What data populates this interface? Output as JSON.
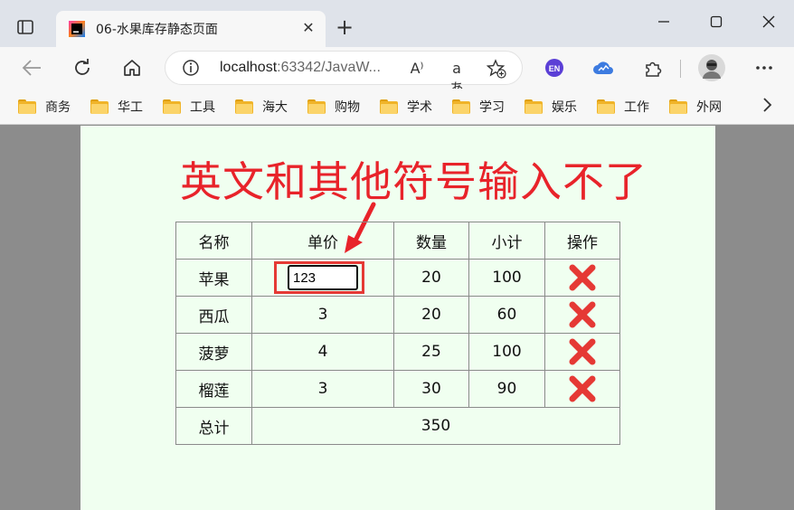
{
  "browser": {
    "tab_title": "06-水果库存静态页面",
    "tab_close": "✕",
    "new_tab": "+",
    "address_host": "localhost",
    "address_rest": ":63342/JavaW...",
    "read_aloud_icon": "A⁾",
    "translate_icon": "aあ",
    "extension_en": "EN",
    "bookmarks": [
      "商务",
      "华工",
      "工具",
      "海大",
      "购物",
      "学术",
      "学习",
      "娱乐",
      "工作",
      "外网"
    ]
  },
  "page": {
    "headline": "英文和其他符号输入不了",
    "table": {
      "headers": [
        "名称",
        "单价",
        "数量",
        "小计",
        "操作"
      ],
      "rows": [
        {
          "name": "苹果",
          "price": "123",
          "qty": "20",
          "subtotal": "100"
        },
        {
          "name": "西瓜",
          "price": "3",
          "qty": "20",
          "subtotal": "60"
        },
        {
          "name": "菠萝",
          "price": "4",
          "qty": "25",
          "subtotal": "100"
        },
        {
          "name": "榴莲",
          "price": "3",
          "qty": "30",
          "subtotal": "90"
        }
      ],
      "total_label": "总计",
      "total_value": "350"
    },
    "colors": {
      "annotation_red": "#e8232a",
      "delete_red": "#e53935",
      "page_bg": "#f0fff0"
    }
  }
}
